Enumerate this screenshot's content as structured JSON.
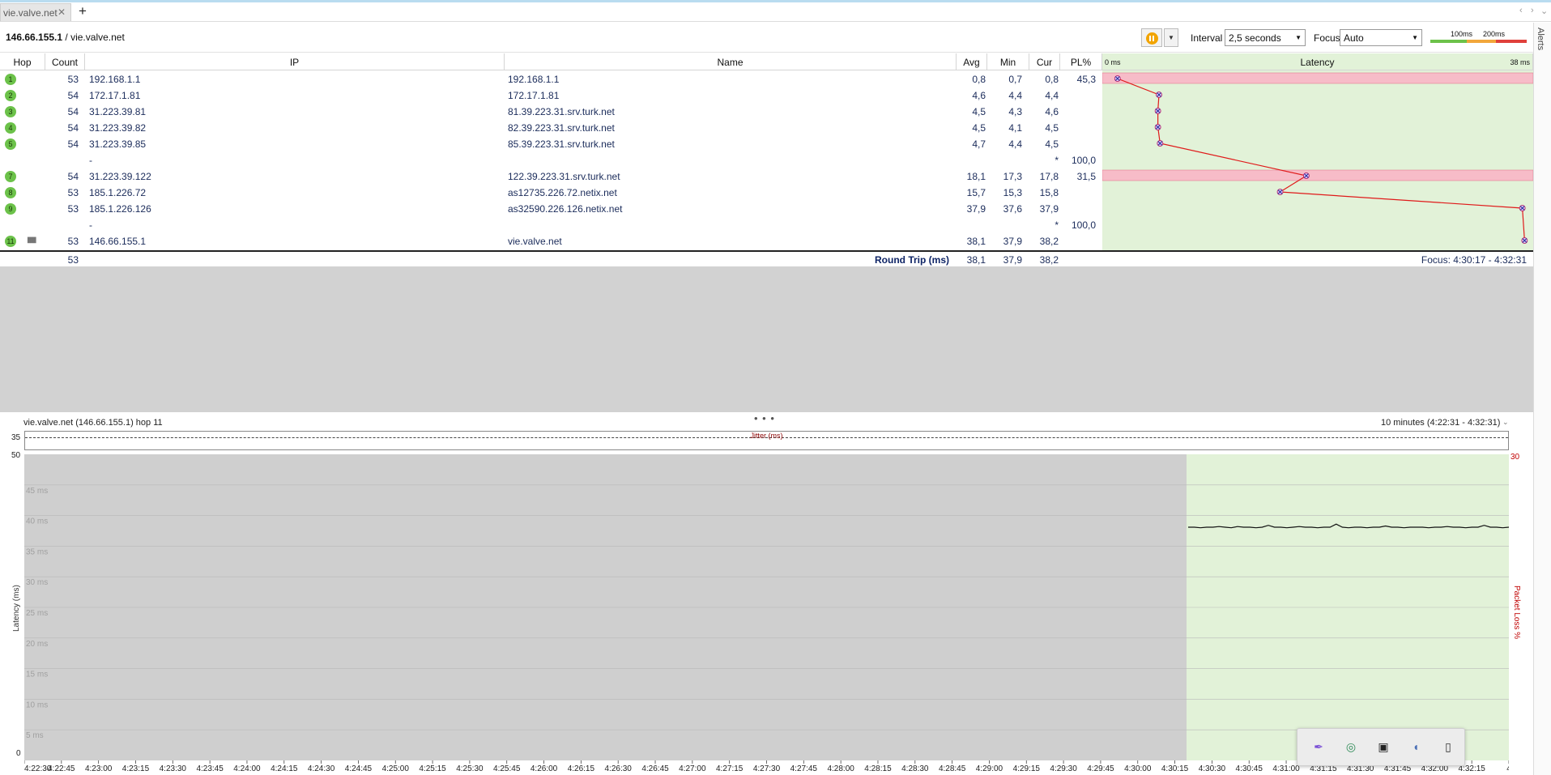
{
  "tab": {
    "title": "vie.valve.net",
    "close": "✕",
    "new": "+"
  },
  "toolbar": {
    "target_ip": "146.66.155.1",
    "target_sep": " / ",
    "target_host": "vie.valve.net",
    "interval_label": "Interval",
    "interval_value": "2,5 seconds",
    "focus_label": "Focus",
    "focus_value": "Auto",
    "legend_100": "100ms",
    "legend_200": "200ms"
  },
  "alerts_label": "Alerts",
  "columns": {
    "hop": "Hop",
    "count": "Count",
    "ip": "IP",
    "name": "Name",
    "avg": "Avg",
    "min": "Min",
    "cur": "Cur",
    "pl": "PL%",
    "latency": "Latency",
    "lat_min": "0 ms",
    "lat_max": "38 ms"
  },
  "rows": [
    {
      "hop": "1",
      "count": "53",
      "ip": "192.168.1.1",
      "name": "192.168.1.1",
      "avg": "0,8",
      "min": "0,7",
      "cur": "0,8",
      "pl": "45,3"
    },
    {
      "hop": "2",
      "count": "54",
      "ip": "172.17.1.81",
      "name": "172.17.1.81",
      "avg": "4,6",
      "min": "4,4",
      "cur": "4,4",
      "pl": ""
    },
    {
      "hop": "3",
      "count": "54",
      "ip": "31.223.39.81",
      "name": "81.39.223.31.srv.turk.net",
      "avg": "4,5",
      "min": "4,3",
      "cur": "4,6",
      "pl": ""
    },
    {
      "hop": "4",
      "count": "54",
      "ip": "31.223.39.82",
      "name": "82.39.223.31.srv.turk.net",
      "avg": "4,5",
      "min": "4,1",
      "cur": "4,5",
      "pl": ""
    },
    {
      "hop": "5",
      "count": "54",
      "ip": "31.223.39.85",
      "name": "85.39.223.31.srv.turk.net",
      "avg": "4,7",
      "min": "4,4",
      "cur": "4,5",
      "pl": ""
    },
    {
      "hop": "",
      "count": "",
      "ip": "-",
      "name": "",
      "avg": "",
      "min": "",
      "cur": "*",
      "pl": "100,0"
    },
    {
      "hop": "7",
      "count": "54",
      "ip": "31.223.39.122",
      "name": "122.39.223.31.srv.turk.net",
      "avg": "18,1",
      "min": "17,3",
      "cur": "17,8",
      "pl": "31,5"
    },
    {
      "hop": "8",
      "count": "53",
      "ip": "185.1.226.72",
      "name": "as12735.226.72.netix.net",
      "avg": "15,7",
      "min": "15,3",
      "cur": "15,8",
      "pl": ""
    },
    {
      "hop": "9",
      "count": "53",
      "ip": "185.1.226.126",
      "name": "as32590.226.126.netix.net",
      "avg": "37,9",
      "min": "37,6",
      "cur": "37,9",
      "pl": ""
    },
    {
      "hop": "",
      "count": "",
      "ip": "-",
      "name": "",
      "avg": "",
      "min": "",
      "cur": "*",
      "pl": "100,0"
    },
    {
      "hop": "11",
      "count": "53",
      "ip": "146.66.155.1",
      "name": "vie.valve.net",
      "avg": "38,1",
      "min": "37,9",
      "cur": "38,2",
      "pl": ""
    }
  ],
  "summary": {
    "count": "53",
    "label": "Round Trip (ms)",
    "avg": "38,1",
    "min": "37,9",
    "cur": "38,2",
    "focus": "Focus: 4:30:17 - 4:32:31"
  },
  "latency_graph": {
    "min_ms": 0,
    "max_ms": 38,
    "avg_values": [
      0.8,
      4.6,
      4.5,
      4.5,
      4.7,
      null,
      18.1,
      15.7,
      37.9,
      null,
      38.1
    ],
    "loss_rows": [
      0,
      6
    ]
  },
  "lower": {
    "title": "vie.valve.net (146.66.155.1) hop 11",
    "range": "10 minutes (4:22:31 - 4:32:31)",
    "jitter_label": "Jitter (ms)",
    "jitter_max": "35",
    "y_max": "50",
    "y_min": "0",
    "y_label": "Latency (ms)",
    "right_max": "30",
    "right_label": "Packet Loss %",
    "y_ticks": [
      "45 ms",
      "40 ms",
      "35 ms",
      "30 ms",
      "25 ms",
      "20 ms",
      "15 ms",
      "10 ms",
      "5 ms"
    ],
    "x_ticks": [
      "4:22:30",
      "4:22:45",
      "4:23:00",
      "4:23:15",
      "4:23:30",
      "4:23:45",
      "4:24:00",
      "4:24:15",
      "4:24:30",
      "4:24:45",
      "4:25:00",
      "4:25:15",
      "4:25:30",
      "4:25:45",
      "4:26:00",
      "4:26:15",
      "4:26:30",
      "4:26:45",
      "4:27:00",
      "4:27:15",
      "4:27:30",
      "4:27:45",
      "4:28:00",
      "4:28:15",
      "4:28:30",
      "4:28:45",
      "4:29:00",
      "4:29:15",
      "4:29:30",
      "4:29:45",
      "4:30:00",
      "4:30:15",
      "4:30:30",
      "4:30:45",
      "4:31:00",
      "4:31:15",
      "4:31:30",
      "4:31:45",
      "4:32:00",
      "4:32:15",
      "4"
    ]
  },
  "chart_data": {
    "type": "line",
    "xlabel": "",
    "ylabel": "Latency (ms)",
    "ylim": [
      0,
      50
    ],
    "y2label": "Packet Loss %",
    "y2lim": [
      0,
      30
    ],
    "x_start": "4:22:30",
    "x_end": "4:32:31",
    "focus_start": "4:30:17",
    "series": [
      {
        "values": [
          38.1,
          38.1,
          38.0,
          38.1,
          38.1,
          38.2,
          38.1,
          38.0,
          38.2,
          38.1,
          38.1,
          38.0,
          38.1,
          38.4,
          38.1,
          38.1,
          38.0,
          38.1,
          38.2,
          38.1,
          38.1,
          38.0,
          38.1,
          38.1,
          38.6,
          38.1,
          38.0,
          38.1,
          38.1,
          38.0,
          38.1,
          38.1,
          38.3,
          38.1,
          38.1,
          38.0,
          38.1,
          38.1,
          38.1,
          38.0,
          38.1,
          38.1,
          38.2,
          38.1,
          38.1,
          38.0,
          38.1,
          38.1,
          38.4,
          38.1,
          38.1,
          38.0,
          38.1
        ]
      }
    ]
  },
  "tray": {
    "icons": [
      "pen-icon",
      "gaming-icon",
      "nvidia-icon",
      "speaker-icon",
      "usb-icon"
    ]
  }
}
